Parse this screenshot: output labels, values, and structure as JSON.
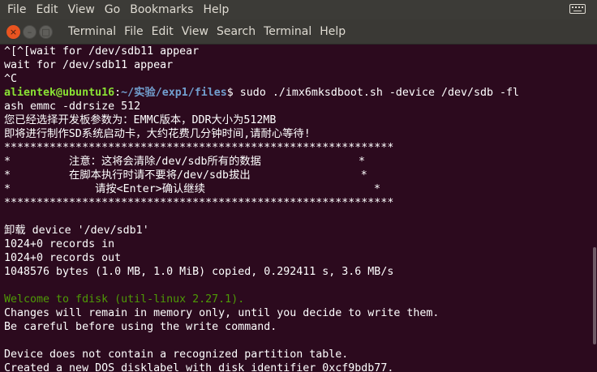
{
  "system_menu": [
    "File",
    "Edit",
    "View",
    "Go",
    "Bookmarks",
    "Help"
  ],
  "window": {
    "menu": [
      "Terminal",
      "File",
      "Edit",
      "View",
      "Search",
      "Terminal",
      "Help"
    ],
    "buttons": {
      "close": "×",
      "minimize": "–",
      "maximize": "□"
    }
  },
  "terminal": {
    "lines": [
      "^[^[wait for /dev/sdb11 appear",
      "wait for /dev/sdb11 appear",
      "^C",
      {
        "prompt_user": "alientek@ubuntu16",
        "prompt_sep": ":",
        "prompt_path": "~/实验/exp1/files",
        "prompt_end": "$ ",
        "command": "sudo ./imx6mksdboot.sh -device /dev/sdb -fl"
      },
      "ash emmc -ddrsize 512",
      "您已经选择开发板参数为：EMMC版本，DDR大小为512MB",
      "即将进行制作SD系统启动卡，大约花费几分钟时间,请耐心等待!",
      "************************************************************",
      "*         注意：这将会清除/dev/sdb所有的数据               *",
      "*         在脚本执行时请不要将/dev/sdb拔出                 *",
      "*             请按<Enter>确认继续                          *",
      "************************************************************",
      "",
      "卸载 device '/dev/sdb1'",
      "1024+0 records in",
      "1024+0 records out",
      "1048576 bytes (1.0 MB, 1.0 MiB) copied, 0.292411 s, 3.6 MB/s",
      "",
      {
        "green": "Welcome to fdisk (util-linux 2.27.1)."
      },
      "Changes will remain in memory only, until you decide to write them.",
      "Be careful before using the write command.",
      "",
      "Device does not contain a recognized partition table.",
      "Created a new DOS disklabel with disk identifier 0xcf9bdb77."
    ]
  },
  "colors": {
    "background": "#2c0a1e",
    "prompt_user": "#8ae234",
    "prompt_path": "#729fcf",
    "fdisk_welcome": "#4e9a06",
    "close_button": "#e95420"
  }
}
